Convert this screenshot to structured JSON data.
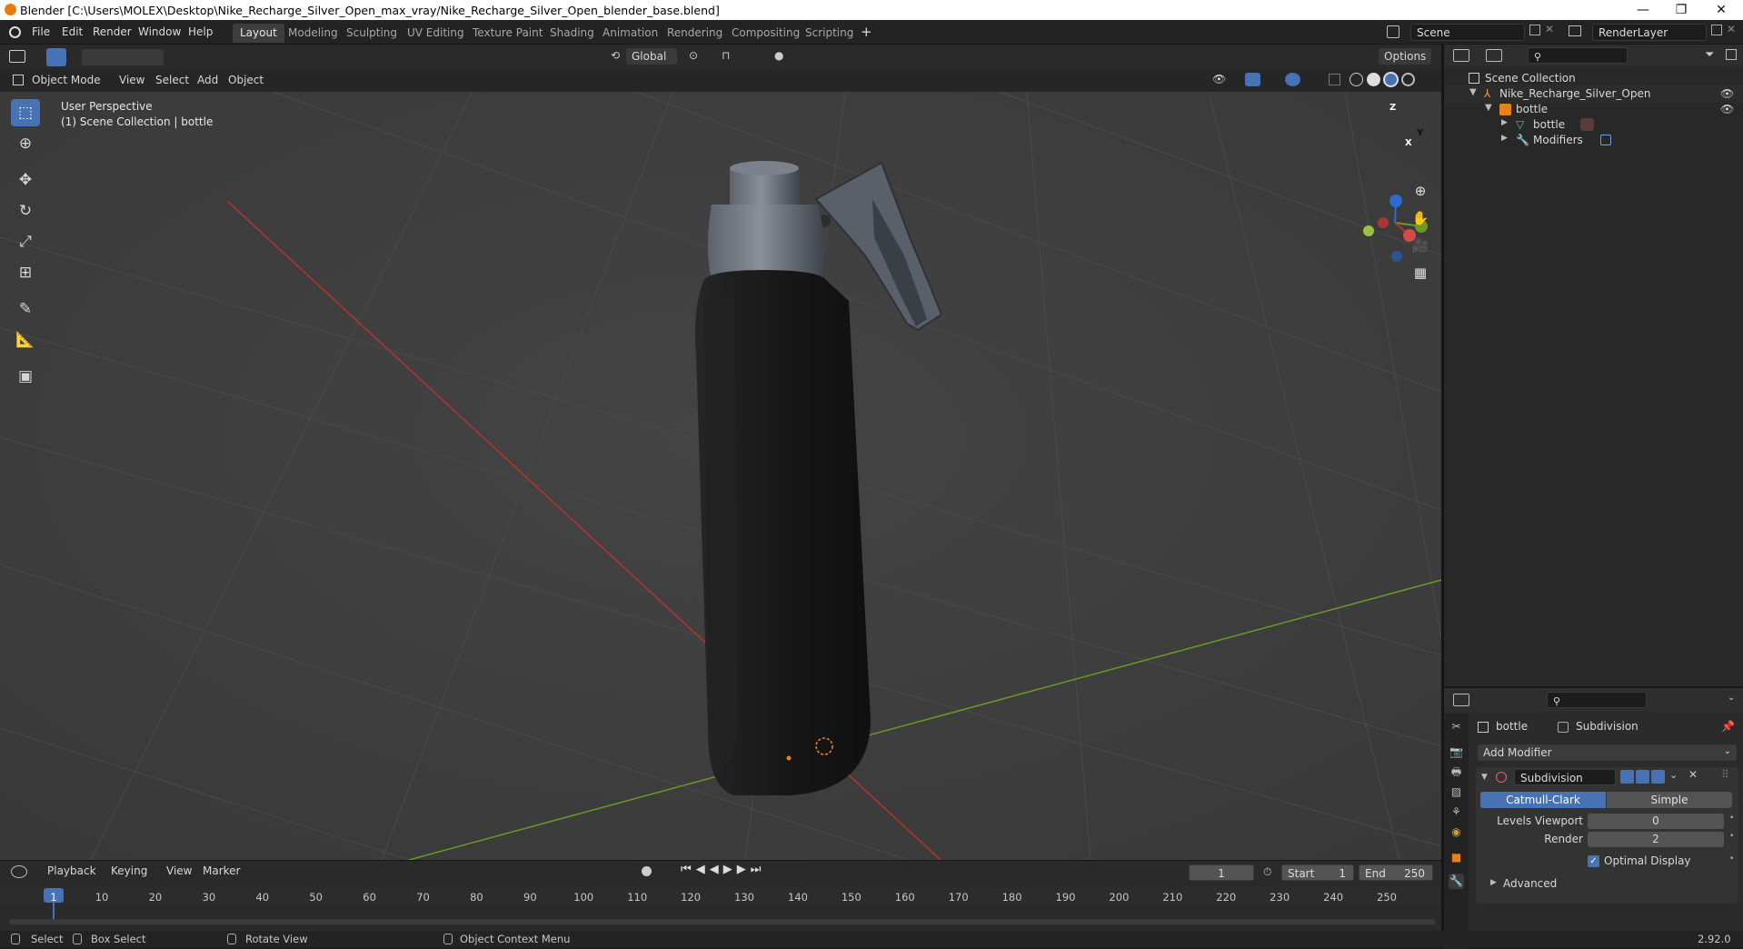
{
  "title_bar": {
    "title": "Blender [C:\\Users\\MOLEX\\Desktop\\Nike_Recharge_Silver_Open_max_vray/Nike_Recharge_Silver_Open_blender_base.blend]",
    "minimize": "—",
    "restore": "❐",
    "close": "✕"
  },
  "menubar": {
    "items": [
      "File",
      "Edit",
      "Render",
      "Window",
      "Help"
    ],
    "workspaces": [
      "Layout",
      "Modeling",
      "Sculpting",
      "UV Editing",
      "Texture Paint",
      "Shading",
      "Animation",
      "Rendering",
      "Compositing",
      "Scripting"
    ],
    "active_workspace": "Layout",
    "add_workspace": "+",
    "scene": "Scene",
    "render_layer": "RenderLayer"
  },
  "viewport_header": {
    "transform_orientation": "Global",
    "options": "Options",
    "mode": "Object Mode",
    "menus": [
      "View",
      "Select",
      "Add",
      "Object"
    ]
  },
  "viewport": {
    "perspective": "User Perspective",
    "collection_info": "(1) Scene Collection | bottle",
    "gizmo_axes": [
      "Z",
      "Y",
      "X"
    ]
  },
  "outliner": {
    "root": "Scene Collection",
    "items": [
      {
        "label": "Nike_Recharge_Silver_Open",
        "indent": 1
      },
      {
        "label": "bottle",
        "indent": 2
      },
      {
        "label": "bottle",
        "indent": 3
      },
      {
        "label": "Modifiers",
        "indent": 3
      }
    ]
  },
  "properties": {
    "breadcrumb_object": "bottle",
    "breadcrumb_modifier": "Subdivision",
    "add_modifier": "Add Modifier",
    "modifier_name": "Subdivision",
    "type_catmull": "Catmull-Clark",
    "type_simple": "Simple",
    "levels_viewport_label": "Levels Viewport",
    "levels_viewport_value": "0",
    "render_label": "Render",
    "render_value": "2",
    "optimal_display": "Optimal Display",
    "advanced": "Advanced"
  },
  "timeline": {
    "menus": [
      "Playback",
      "Keying",
      "View",
      "Marker"
    ],
    "current_frame": "1",
    "start_label": "Start",
    "start_value": "1",
    "end_label": "End",
    "end_value": "250",
    "ticks": [
      "1",
      "10",
      "20",
      "30",
      "40",
      "50",
      "60",
      "70",
      "80",
      "90",
      "100",
      "110",
      "120",
      "130",
      "140",
      "150",
      "160",
      "170",
      "180",
      "190",
      "200",
      "210",
      "220",
      "230",
      "240",
      "250"
    ]
  },
  "statusbar": {
    "select": "Select",
    "box_select": "Box Select",
    "rotate_view": "Rotate View",
    "context_menu": "Object Context Menu",
    "version": "2.92.0"
  },
  "colors": {
    "accent": "#4772b3",
    "x_axis": "#b53333",
    "y_axis": "#6a9a24",
    "z_axis": "#2f6ad0",
    "origin": "#e8811b"
  }
}
